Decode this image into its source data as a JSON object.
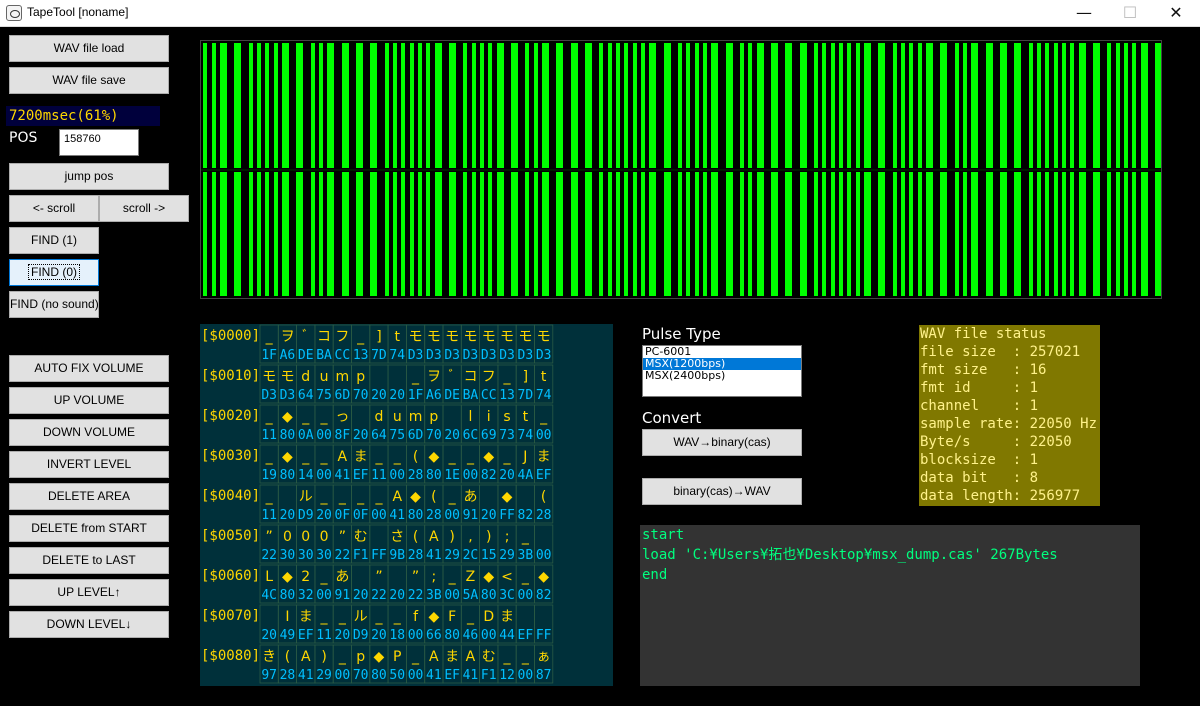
{
  "window": {
    "title": "TapeTool [noname]",
    "minimize": "—",
    "maximize": "☐",
    "close": "✕"
  },
  "sidebar": {
    "wav_load": "WAV file load",
    "wav_save": "WAV file save",
    "time_display": "7200msec(61%)",
    "pos_label": "POS",
    "pos_value": "158760",
    "jump_pos": "jump pos",
    "scroll_left": "<- scroll",
    "scroll_right": "scroll ->",
    "find1": "FIND (1)",
    "find0": "FIND (0)",
    "find_nosound": "FIND (no sound)",
    "auto_fix_volume": "AUTO FIX VOLUME",
    "up_volume": "UP VOLUME",
    "down_volume": "DOWN VOLUME",
    "invert_level": "INVERT LEVEL",
    "delete_area": "DELETE AREA",
    "delete_from_start": "DELETE from START",
    "delete_to_last": "DELETE to LAST",
    "up_level": "UP LEVEL↑",
    "down_level": "DOWN LEVEL↓"
  },
  "waveform": {
    "color": "#00ff00",
    "background": "#000000"
  },
  "hexdump": {
    "address_color": "#ffd700",
    "glyph_color": "#ffd700",
    "byte_color": "#00bfff",
    "rows": [
      {
        "addr": "[$0000]",
        "glyphs": [
          "_",
          "ヲ",
          "ﾞ",
          "コ",
          "フ",
          "_",
          "]",
          "t",
          "モ",
          "モ",
          "モ",
          "モ",
          "モ",
          "モ",
          "モ",
          "モ"
        ],
        "bytes": [
          "1F",
          "A6",
          "DE",
          "BA",
          "CC",
          "13",
          "7D",
          "74",
          "D3",
          "D3",
          "D3",
          "D3",
          "D3",
          "D3",
          "D3",
          "D3"
        ]
      },
      {
        "addr": "[$0010]",
        "glyphs": [
          "モ",
          "モ",
          "d",
          "u",
          "m",
          "p",
          "",
          "",
          "_",
          "ヲ",
          "ﾞ",
          "コ",
          "フ",
          "_",
          "]",
          "t"
        ],
        "bytes": [
          "D3",
          "D3",
          "64",
          "75",
          "6D",
          "70",
          "20",
          "20",
          "1F",
          "A6",
          "DE",
          "BA",
          "CC",
          "13",
          "7D",
          "74"
        ]
      },
      {
        "addr": "[$0020]",
        "glyphs": [
          "_",
          "◆",
          "_",
          "_",
          "っ",
          "",
          "d",
          "u",
          "m",
          "p",
          "",
          "l",
          "i",
          "s",
          "t",
          "_"
        ],
        "bytes": [
          "11",
          "80",
          "0A",
          "00",
          "8F",
          "20",
          "64",
          "75",
          "6D",
          "70",
          "20",
          "6C",
          "69",
          "73",
          "74",
          "00"
        ]
      },
      {
        "addr": "[$0030]",
        "glyphs": [
          "_",
          "◆",
          "_",
          "_",
          "A",
          "ま",
          "_",
          "_",
          "(",
          "◆",
          "_",
          "_",
          "◆",
          "_",
          "J",
          "ま"
        ],
        "bytes": [
          "19",
          "80",
          "14",
          "00",
          "41",
          "EF",
          "11",
          "00",
          "28",
          "80",
          "1E",
          "00",
          "82",
          "20",
          "4A",
          "EF"
        ]
      },
      {
        "addr": "[$0040]",
        "glyphs": [
          "_",
          "",
          "ル",
          "_",
          "_",
          "_",
          "_",
          "A",
          "◆",
          "(",
          "_",
          "あ",
          "",
          "◆",
          "",
          "("
        ],
        "bytes": [
          "11",
          "20",
          "D9",
          "20",
          "0F",
          "0F",
          "00",
          "41",
          "80",
          "28",
          "00",
          "91",
          "20",
          "FF",
          "82",
          "28"
        ]
      },
      {
        "addr": "[$0050]",
        "glyphs": [
          "”",
          "0",
          "0",
          "0",
          "”",
          "む",
          "",
          "さ",
          "(",
          "A",
          ")",
          ",",
          ")",
          ";",
          "_",
          ""
        ],
        "bytes": [
          "22",
          "30",
          "30",
          "30",
          "22",
          "F1",
          "FF",
          "9B",
          "28",
          "41",
          "29",
          "2C",
          "15",
          "29",
          "3B",
          "00"
        ]
      },
      {
        "addr": "[$0060]",
        "glyphs": [
          "L",
          "◆",
          "2",
          "_",
          "あ",
          "",
          "”",
          "",
          "”",
          ";",
          "_",
          "Z",
          "◆",
          "<",
          "_",
          "◆"
        ],
        "bytes": [
          "4C",
          "80",
          "32",
          "00",
          "91",
          "20",
          "22",
          "20",
          "22",
          "3B",
          "00",
          "5A",
          "80",
          "3C",
          "00",
          "82"
        ]
      },
      {
        "addr": "[$0070]",
        "glyphs": [
          "",
          "I",
          "ま",
          "_",
          "_",
          "ル",
          "_",
          "_",
          "f",
          "◆",
          "F",
          "_",
          "D",
          "ま",
          "",
          ""
        ],
        "bytes": [
          "20",
          "49",
          "EF",
          "11",
          "20",
          "D9",
          "20",
          "18",
          "00",
          "66",
          "80",
          "46",
          "00",
          "44",
          "EF",
          "FF"
        ]
      },
      {
        "addr": "[$0080]",
        "glyphs": [
          "き",
          "(",
          "A",
          ")",
          "_",
          "p",
          "◆",
          "P",
          "_",
          "A",
          "ま",
          "A",
          "む",
          "_",
          "_",
          "ぁ"
        ],
        "bytes": [
          "97",
          "28",
          "41",
          "29",
          "00",
          "70",
          "80",
          "50",
          "00",
          "41",
          "EF",
          "41",
          "F1",
          "12",
          "00",
          "87"
        ]
      }
    ]
  },
  "pulse": {
    "label": "Pulse Type",
    "options": [
      "PC-6001",
      "MSX(1200bps)",
      "MSX(2400bps)"
    ],
    "selected_index": 1
  },
  "convert": {
    "label": "Convert",
    "wav_to_bin": "WAV→binary(cas)",
    "bin_to_wav": "binary(cas)→WAV"
  },
  "wav_status": {
    "lines": [
      "WAV file status",
      "file size  : 257021",
      "fmt size   : 16",
      "fmt id     : 1",
      "channel    : 1",
      "sample rate: 22050 Hz",
      "Byte/s     : 22050",
      "blocksize  : 1",
      "data bit   : 8",
      "data length: 256977"
    ]
  },
  "log": {
    "lines": [
      "start",
      "load 'C:¥Users¥拓也¥Desktop¥msx_dump.cas' 267Bytes",
      "end"
    ]
  }
}
